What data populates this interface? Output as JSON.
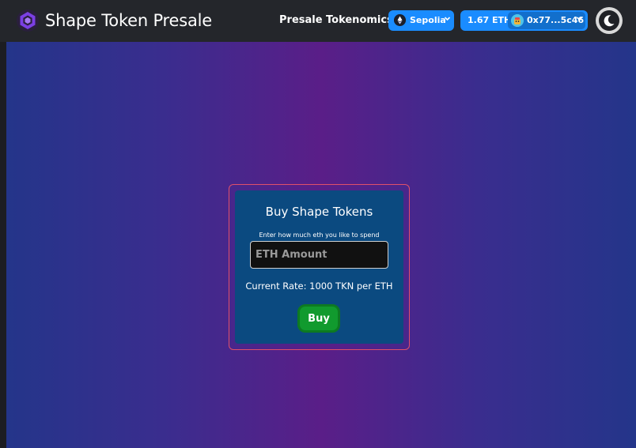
{
  "navbar": {
    "title": "Shape Token Presale",
    "links": [
      "Presale",
      "Tokenomics"
    ],
    "network": {
      "label": "Sepolia",
      "icon": "ethereum-icon"
    },
    "account": {
      "balance": "1.67 ETH",
      "address": "0x77...5c46",
      "avatar": "avatar-icon"
    },
    "theme_icon": "moon-icon"
  },
  "card": {
    "title": "Buy Shape Tokens",
    "hint": "Enter how much eth you like to spend",
    "input_placeholder": "ETH Amount",
    "input_value": "",
    "rate": "Current Rate: 1000 TKN per ETH",
    "buy_label": "Buy"
  },
  "colors": {
    "navbar_bg": "#24262b",
    "accent_blue": "#1a8cff",
    "card_bg": "#0b4a80",
    "frame_border": "#e0506a",
    "buy_green": "#119a2e",
    "gradient_center": "#5a1e88",
    "gradient_edge": "#24358a"
  }
}
